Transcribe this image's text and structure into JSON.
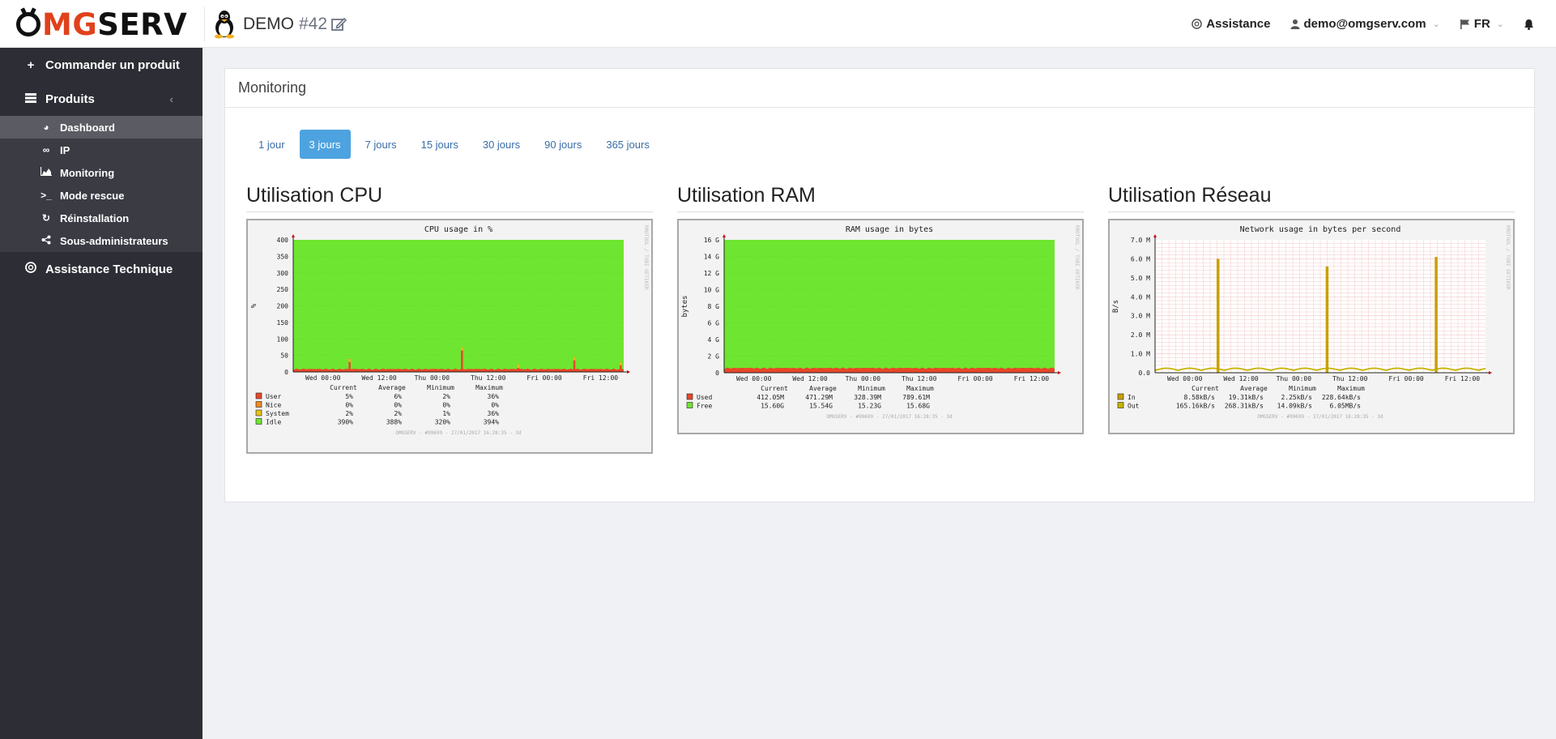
{
  "brand": {
    "o": "O",
    "mg": "MG",
    "serv": "SERV"
  },
  "server": {
    "name": "DEMO",
    "number": "#42"
  },
  "topnav": {
    "assistance": "Assistance",
    "email": "demo@omgserv.com",
    "lang": "FR"
  },
  "sidebar": {
    "order": "Commander un produit",
    "products": "Produits",
    "sub": [
      {
        "label": "Dashboard",
        "icon": "dashboard-icon"
      },
      {
        "label": "IP",
        "icon": "link-icon"
      },
      {
        "label": "Monitoring",
        "icon": "area-chart-icon"
      },
      {
        "label": "Mode rescue",
        "icon": "terminal-icon"
      },
      {
        "label": "Réinstallation",
        "icon": "refresh-icon"
      },
      {
        "label": "Sous-administrateurs",
        "icon": "share-icon"
      }
    ],
    "support": "Assistance Technique"
  },
  "panel": {
    "title": "Monitoring"
  },
  "tabs": [
    "1 jour",
    "3 jours",
    "7 jours",
    "15 jours",
    "30 jours",
    "90 jours",
    "365 jours"
  ],
  "active_tab": "3 jours",
  "graphs": {
    "cpu": {
      "heading": "Utilisation CPU"
    },
    "ram": {
      "heading": "Utilisation RAM"
    },
    "net": {
      "heading": "Utilisation Réseau"
    }
  },
  "chart_data": [
    {
      "type": "area",
      "title": "CPU usage in %",
      "ylabel": "%",
      "ylim": [
        0,
        400
      ],
      "yticks": [
        "400",
        "350",
        "300",
        "250",
        "200",
        "150",
        "100",
        "50",
        "0"
      ],
      "x": [
        "Wed 00:00",
        "Wed 12:00",
        "Thu 00:00",
        "Thu 12:00",
        "Fri 00:00",
        "Fri 12:00"
      ],
      "series": [
        {
          "name": "User"
        },
        {
          "name": "Nice"
        },
        {
          "name": "System"
        },
        {
          "name": "Idle"
        }
      ],
      "spikes": [
        {
          "x": 0.17,
          "v": 40
        },
        {
          "x": 0.51,
          "v": 75
        },
        {
          "x": 0.68,
          "v": 22
        },
        {
          "x": 0.85,
          "v": 45
        },
        {
          "x": 0.99,
          "v": 30
        }
      ],
      "legend_head": [
        "Current",
        "Average",
        "Minimum",
        "Maximum"
      ],
      "legend_rows": [
        [
          "User",
          "5%",
          "6%",
          "2%",
          "36%"
        ],
        [
          "Nice",
          "0%",
          "0%",
          "0%",
          "0%"
        ],
        [
          "System",
          "2%",
          "2%",
          "1%",
          "36%"
        ],
        [
          "Idle",
          "390%",
          "388%",
          "320%",
          "394%"
        ]
      ],
      "colors": [
        "#e8462a",
        "#f08a22",
        "#e8c21c",
        "#6ee530"
      ],
      "footer": "OMGSERV - #99699 - 27/01/2017 16:28:35 - 3d",
      "side_text": "RRDTOOL / TOBI OETIKER"
    },
    {
      "type": "area",
      "title": "RAM usage in bytes",
      "ylabel": "bytes",
      "ylim": [
        0,
        16
      ],
      "yticks": [
        "16 G",
        "14 G",
        "12 G",
        "10 G",
        "8 G",
        "6 G",
        "4 G",
        "2 G",
        "0"
      ],
      "x": [
        "Wed 00:00",
        "Wed 12:00",
        "Thu 00:00",
        "Thu 12:00",
        "Fri 00:00",
        "Fri 12:00"
      ],
      "series": [
        {
          "name": "Used"
        },
        {
          "name": "Free"
        }
      ],
      "legend_head": [
        "Current",
        "Average",
        "Minimum",
        "Maximum"
      ],
      "legend_rows": [
        [
          "Used",
          "412.05M",
          "471.29M",
          "328.39M",
          "789.61M"
        ],
        [
          "Free",
          "15.60G",
          "15.54G",
          "15.23G",
          "15.68G"
        ]
      ],
      "colors": [
        "#e8462a",
        "#6ee530"
      ],
      "footer": "OMGSERV - #99699 - 27/01/2017 16:28:35 - 3d",
      "side_text": "RRDTOOL / TOBI OETIKER"
    },
    {
      "type": "line",
      "title": "Network usage in bytes per second",
      "ylabel": "B/s",
      "ylim": [
        0,
        7
      ],
      "yticks": [
        "7.0 M",
        "6.0 M",
        "5.0 M",
        "4.0 M",
        "3.0 M",
        "2.0 M",
        "1.0 M",
        "0.0"
      ],
      "x": [
        "Wed 00:00",
        "Wed 12:00",
        "Thu 00:00",
        "Thu 12:00",
        "Fri 00:00",
        "Fri 12:00"
      ],
      "series": [
        {
          "name": "In"
        },
        {
          "name": "Out"
        }
      ],
      "spikes": [
        {
          "x": 0.19,
          "v": 6.0
        },
        {
          "x": 0.52,
          "v": 5.6
        },
        {
          "x": 0.85,
          "v": 6.1
        }
      ],
      "legend_head": [
        "Current",
        "Average",
        "Minimum",
        "Maximum"
      ],
      "legend_rows": [
        [
          "In",
          "8.58kB/s",
          "19.31kB/s",
          "2.25kB/s",
          "228.64kB/s"
        ],
        [
          "Out",
          "165.16kB/s",
          "268.31kB/s",
          "14.09kB/s",
          "6.05MB/s"
        ]
      ],
      "colors": [
        "#c8a000",
        "#c8b400"
      ],
      "footer": "OMGSERV - #99699 - 27/01/2017 16:28:35 - 3d",
      "side_text": "RRDTOOL / TOBI OETIKER"
    }
  ]
}
